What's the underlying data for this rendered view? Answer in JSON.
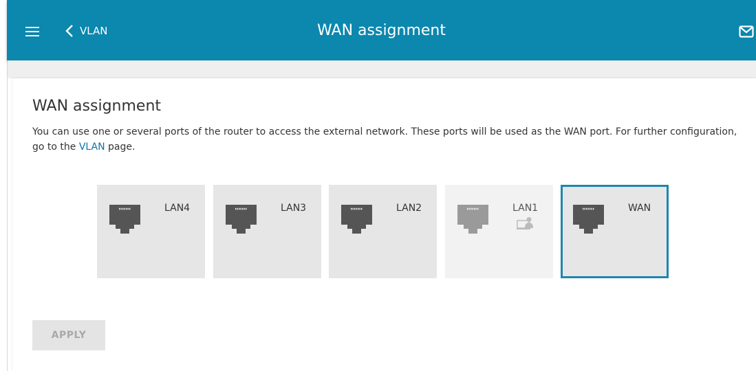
{
  "header": {
    "back_label": "VLAN",
    "title": "WAN assignment"
  },
  "main": {
    "title": "WAN assignment",
    "description_before_link": "You can use one or several ports of the router to access the external network. These ports will be used as the WAN port. For further configuration, go to the ",
    "description_link": "VLAN",
    "description_after_link": " page.",
    "ports": [
      {
        "label": "LAN4",
        "state": "available"
      },
      {
        "label": "LAN3",
        "state": "available"
      },
      {
        "label": "LAN2",
        "state": "available"
      },
      {
        "label": "LAN1",
        "state": "disabled",
        "icon": "computer-icon"
      },
      {
        "label": "WAN",
        "state": "selected"
      }
    ],
    "apply_label": "APPLY"
  },
  "colors": {
    "header_bg": "#0c87ad",
    "link": "#0c73a4",
    "selected_border": "#1d86ad",
    "port_bg": "#e6e6e6",
    "port_disabled_bg": "#f2f2f2",
    "jack": "#555555",
    "jack_disabled": "#9a9a9a"
  },
  "icons": [
    "menu-icon",
    "chevron-left-icon",
    "mail-icon",
    "ethernet-port-icon",
    "computer-icon"
  ]
}
